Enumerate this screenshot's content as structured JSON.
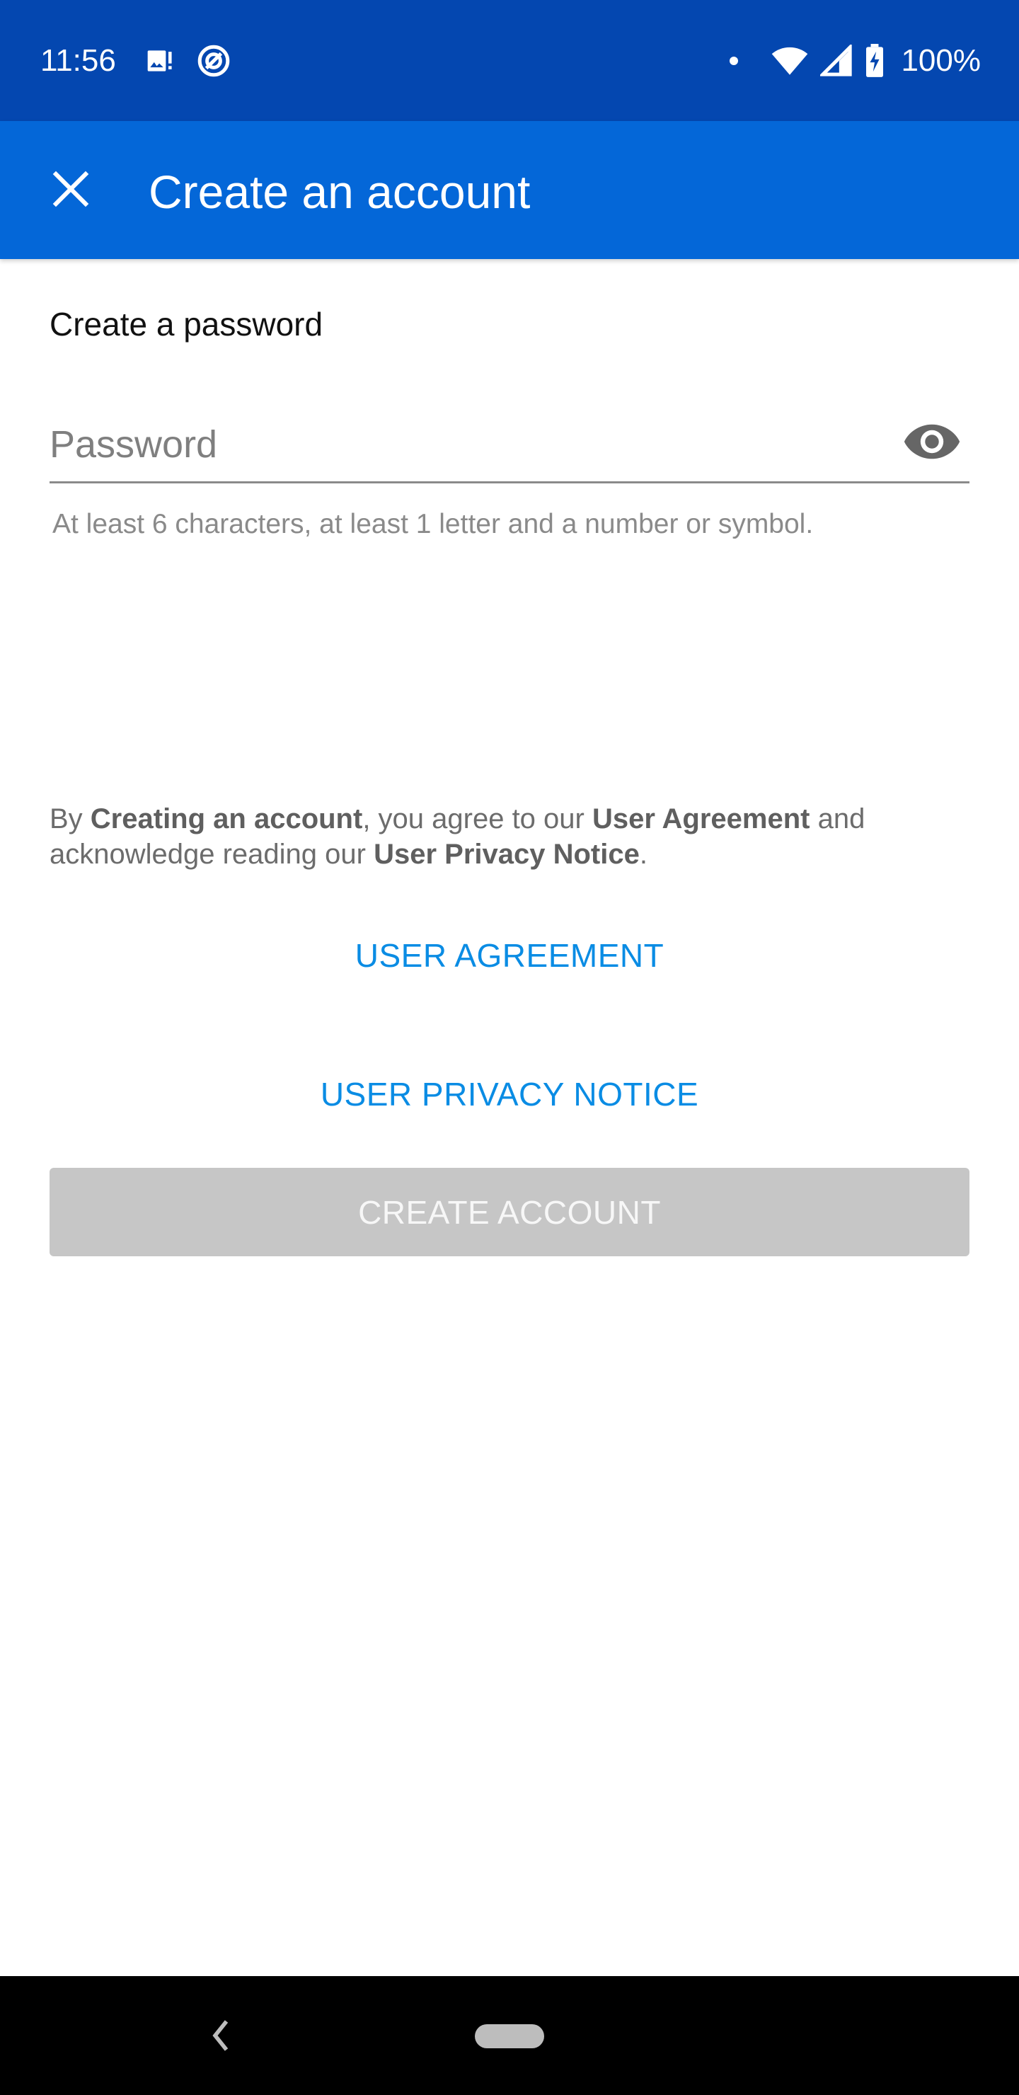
{
  "status_bar": {
    "time": "11:56",
    "battery": "100%",
    "icons": [
      "image-alert-icon",
      "at-sign-icon",
      "notification-dot",
      "wifi-icon",
      "signal-icon",
      "battery-charging-icon"
    ]
  },
  "app_bar": {
    "title": "Create an account",
    "close_icon": "close-icon",
    "background": "#0467d8"
  },
  "form": {
    "label": "Create a password",
    "password_placeholder": "Password",
    "password_value": "",
    "helper": "At least 6 characters, at least 1 letter and a number or symbol.",
    "visibility_icon": "eye-icon"
  },
  "legal": {
    "prefix": "By ",
    "creating": "Creating an account",
    "middle": ", you agree to our ",
    "agreement": "User Agreement",
    "and": " and acknowledge reading our ",
    "privacy": "User Privacy Notice",
    "suffix": "."
  },
  "links": {
    "agreement_label": "USER AGREEMENT",
    "privacy_label": "USER PRIVACY NOTICE",
    "link_color": "#0a8ce4"
  },
  "actions": {
    "create_label": "CREATE ACCOUNT",
    "disabled_color": "#c6c6c6"
  },
  "nav_bar": {
    "icons": [
      "back-icon",
      "home-pill"
    ]
  }
}
